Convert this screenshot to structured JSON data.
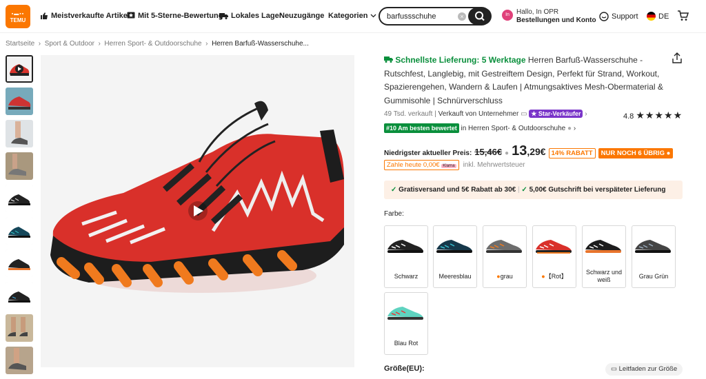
{
  "header": {
    "logo_top": "TEMU",
    "logo_bottom": "TEMU",
    "nav": {
      "bestsellers": "Meistverkaufte Artikel",
      "five_star": "Mit 5-Sterne-Bewertung",
      "local": "Lokales Lager",
      "new": "Neuzugänge",
      "categories": "Kategorien"
    },
    "search_value": "barfussschuhe",
    "account_line1": "Hallo, In OPR",
    "account_line2": "Bestellungen und Konto",
    "avatar": "In",
    "support": "Support",
    "language": "DE"
  },
  "breadcrumb": [
    "Startseite",
    "Sport & Outdoor",
    "Herren Sport- & Outdoorschuhe",
    "Herren Barfuß-Wasserschuhe..."
  ],
  "product": {
    "delivery": "Schnellste Lieferung: 5 Werktage",
    "title": "Herren Barfuß-Wasserschuhe - Rutschfest, Langlebig, mit Gestreiftem Design, Perfekt für Strand, Workout, Spazierengehen, Wandern & Laufen | Atmungsaktives Mesh-Obermaterial & Gummisohle | Schnürverschluss",
    "sold": "49 Tsd. verkauft",
    "seller": "Verkauft von Unternehmer",
    "star_seller": "Star-Verkäufer",
    "rating": "4.8",
    "stars": 5,
    "rank_badge": "#10 Am besten bewertet",
    "rank_category": "in Herren Sport- & Outdoorschuhe",
    "price_label": "Niedrigster aktueller Preis:",
    "old_price": "15,46€",
    "price_int": "13",
    "price_dec": ",29€",
    "discount": "14% RABATT",
    "stock": "NUR NOCH 6 ÜBRIG",
    "pay_today": "Zahle heute 0,00€",
    "pay_brand": "Klarna",
    "vat": "inkl. Mehrwertsteuer",
    "ship1": "Gratisversand und 5€ Rabatt ab 30€",
    "ship2": "5,00€ Gutschrift bei verspäteter Lieferung",
    "color_label": "Farbe:",
    "colors": [
      "Schwarz",
      "Meeresblau",
      "grau",
      "【Rot】",
      "Schwarz und weiß",
      "Grau Grün",
      "Blau Rot"
    ],
    "size_label": "Größe(EU):",
    "size_guide": "Leitfaden zur Größe"
  },
  "colors": {
    "accent": "#fb7701",
    "green": "#0a8f3c",
    "shoe_red": "#e0312a"
  }
}
